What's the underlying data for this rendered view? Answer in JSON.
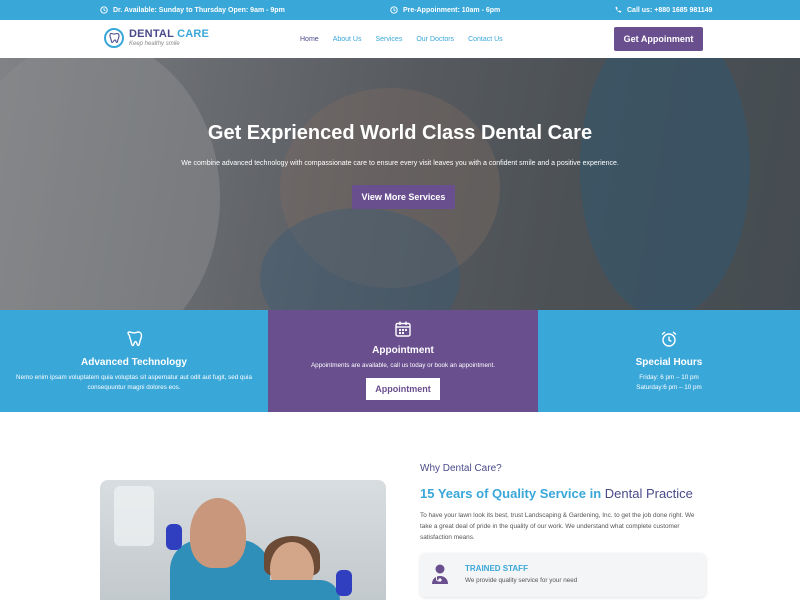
{
  "topbar": {
    "items": [
      {
        "icon": "clock-icon",
        "text": "Dr. Available: Sunday to Thursday Open: 9am - 9pm"
      },
      {
        "icon": "clock-icon",
        "text": "Pre-Appoinment: 10am - 6pm"
      },
      {
        "icon": "phone-icon",
        "text": "Call us: +880 1685 981149"
      }
    ]
  },
  "header": {
    "logo_name_1": "DENTAL",
    "logo_name_2": "CARE",
    "logo_tagline": "Keep healthy smile",
    "menu": [
      "Home",
      "About Us",
      "Services",
      "Our Doctors",
      "Contact Us"
    ],
    "active_menu": "Home",
    "cta_label": "Get Appoinment"
  },
  "hero": {
    "title": "Get Exprienced World Class Dental Care",
    "subtitle": "We combine advanced technology with compassionate care to ensure every visit leaves you with a confident smile and a positive experience.",
    "button_label": "View More Services"
  },
  "features": [
    {
      "icon": "tooth-icon",
      "title": "Advanced Technology",
      "text": "Nemo enim ipsam voluptatem quia voluptas sit aspernatur aut odit aut fugit, sed quia consequuntur magni dolores eos."
    },
    {
      "icon": "calendar-icon",
      "title": "Appointment",
      "text": "Appointments are available, call us today or book an appointment.",
      "button_label": "Appointment"
    },
    {
      "icon": "alarm-clock-icon",
      "title": "Special Hours",
      "lines": [
        "Friday: 6 pm – 10 pm",
        "Saturday:6 pm – 10 pm"
      ]
    }
  ],
  "why": {
    "kicker": "Why Dental Care?",
    "title_highlight": "15 Years of Quality Service in",
    "title_rest": "Dental Practice",
    "paragraph": "To have your lawn look its best, trust Landscaping & Gardening, Inc. to get the job done right. We take a great deal of pride in the quality of our work. We understand what complete customer satisfaction means.",
    "card": {
      "icon": "doctor-icon",
      "title": "TRAINED STAFF",
      "text": "We provide quality service for your need"
    }
  },
  "colors": {
    "primary_blue": "#3aa7d9",
    "primary_purple": "#6a4f8f",
    "heading_dark": "#4a4a8a"
  }
}
